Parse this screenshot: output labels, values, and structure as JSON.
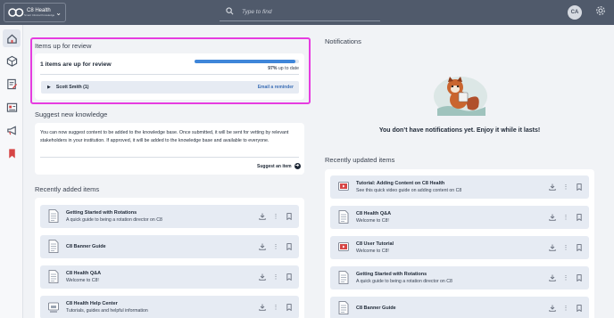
{
  "header": {
    "brand_name": "C8 Health",
    "brand_tagline": "Smart Clinical Knowledge",
    "search_placeholder": "Type to find",
    "avatar_initials": "CA"
  },
  "sidebar": {
    "items": [
      {
        "icon": "home-icon",
        "active": true
      },
      {
        "icon": "cube-icon",
        "active": false
      },
      {
        "icon": "edit-note-icon",
        "active": false
      },
      {
        "icon": "calendar-card-icon",
        "active": false
      },
      {
        "icon": "megaphone-icon",
        "active": false
      },
      {
        "icon": "bookmark-icon",
        "active": false
      }
    ]
  },
  "review": {
    "title": "Items up for review",
    "count_text": "1 items are up for review",
    "progress_percent": 97,
    "progress_value": "97%",
    "progress_suffix": " up to date",
    "reviewer": "Scott Smith (1)",
    "reminder_link": "Email a reminder"
  },
  "suggest": {
    "title": "Suggest new knowledge",
    "body": "You can now suggest content to be added to the knowledge base. Once submitted, it will be sent for vetting by relevant stakeholders in your institution. If approved, it will be added to the knowledge base and available to everyone.",
    "link": "Suggest an item"
  },
  "recently_added": {
    "title": "Recently added items",
    "items": [
      {
        "title": "Getting Started with Rotations",
        "subtitle": "A quick guide to being a rotation director on C8",
        "icon": "document-icon"
      },
      {
        "title": "C8 Banner Guide",
        "subtitle": "",
        "icon": "document-icon"
      },
      {
        "title": "C8 Health Q&A",
        "subtitle": "Welcome to C8!",
        "icon": "document-icon"
      },
      {
        "title": "C8 Health Help Center",
        "subtitle": "Tutorials, guides and helpful information",
        "icon": "help-center-icon"
      }
    ]
  },
  "notifications": {
    "title": "Notifications",
    "empty_text": "You don’t have notifications yet. Enjoy it while it lasts!"
  },
  "recently_updated": {
    "title": "Recently updated items",
    "items": [
      {
        "title": "Tutorial: Adding Content on C8 Health",
        "subtitle": "See this quick video guide on adding content on C8",
        "icon": "video-icon"
      },
      {
        "title": "C8 Health Q&A",
        "subtitle": "Welcome to C8!",
        "icon": "document-icon"
      },
      {
        "title": "C8 User Tutorial",
        "subtitle": "Welcome to C8!",
        "icon": "video-icon"
      },
      {
        "title": "Getting Started with Rotations",
        "subtitle": "A quick guide to being a rotation director on C8",
        "icon": "document-icon"
      },
      {
        "title": "C8 Banner Guide",
        "subtitle": "",
        "icon": "document-icon"
      }
    ]
  },
  "colors": {
    "topbar": "#505a6b",
    "accent": "#3f86d9",
    "highlight": "#e63ce0",
    "item_bg": "#e6ebf3",
    "video_red": "#d64545"
  }
}
